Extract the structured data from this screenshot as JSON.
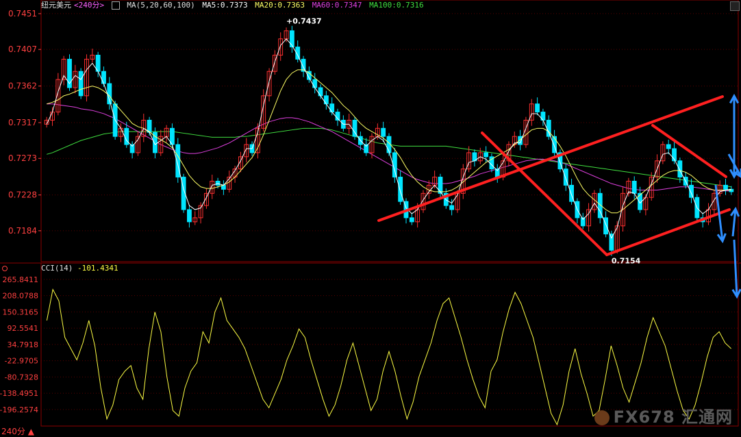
{
  "header": {
    "symbol": "纽元美元",
    "period": "<240分>",
    "ma_icon": "ma-indicator-icon",
    "ma_params": "MA(5,20,60,100)",
    "ma5": "MA5:0.7373",
    "ma20": "MA20:0.7363",
    "ma60": "MA60:0.7347",
    "ma100": "MA100:0.7316"
  },
  "cci_header": {
    "name": "CCI(14)",
    "value": "-101.4341"
  },
  "footer": {
    "period_label": "240分 ▲"
  },
  "watermark": {
    "text": "FX678 汇通网"
  },
  "colors": {
    "up": "#ff3030",
    "down": "#00e5ff",
    "ma5": "#ffffff",
    "ma20": "#ffff66",
    "ma60": "#e040e0",
    "ma100": "#40e040",
    "cci": "#ffff44",
    "trend_red": "#ff2020",
    "arrow_blue": "#2f8fff",
    "axis_text": "#ff4040"
  },
  "chart_data": [
    {
      "type": "candlestick",
      "title": "纽元美元<240分>",
      "ylim": [
        0.7146,
        0.7456
      ],
      "y_ticks": [
        "0.7451",
        "0.7407",
        "0.7362",
        "0.7317",
        "0.7273",
        "0.7228",
        "0.7184"
      ],
      "annotations": [
        {
          "label": "+0.7437",
          "value": 0.7437,
          "kind": "high"
        },
        {
          "label": "0.7154",
          "value": 0.7154,
          "kind": "low"
        }
      ],
      "close": [
        0.732,
        0.733,
        0.737,
        0.7395,
        0.736,
        0.738,
        0.735,
        0.7395,
        0.74,
        0.738,
        0.7365,
        0.734,
        0.73,
        0.731,
        0.729,
        0.728,
        0.73,
        0.732,
        0.7305,
        0.728,
        0.73,
        0.731,
        0.729,
        0.725,
        0.721,
        0.7195,
        0.72,
        0.7215,
        0.723,
        0.7245,
        0.724,
        0.7235,
        0.725,
        0.726,
        0.7275,
        0.729,
        0.728,
        0.731,
        0.735,
        0.738,
        0.74,
        0.742,
        0.743,
        0.741,
        0.7395,
        0.738,
        0.737,
        0.736,
        0.735,
        0.734,
        0.733,
        0.732,
        0.731,
        0.732,
        0.73,
        0.729,
        0.728,
        0.73,
        0.731,
        0.73,
        0.728,
        0.725,
        0.722,
        0.72,
        0.7195,
        0.721,
        0.723,
        0.724,
        0.725,
        0.723,
        0.7215,
        0.721,
        0.723,
        0.726,
        0.728,
        0.727,
        0.728,
        0.7275,
        0.726,
        0.725,
        0.727,
        0.729,
        0.73,
        0.729,
        0.732,
        0.734,
        0.733,
        0.732,
        0.73,
        0.728,
        0.726,
        0.724,
        0.722,
        0.72,
        0.719,
        0.721,
        0.723,
        0.72,
        0.718,
        0.716,
        0.719,
        0.723,
        0.7245,
        0.723,
        0.721,
        0.7225,
        0.725,
        0.727,
        0.729,
        0.7285,
        0.727,
        0.725,
        0.724,
        0.7225,
        0.72,
        0.7195,
        0.721,
        0.723,
        0.724,
        0.7235,
        0.7232
      ],
      "ma": {
        "MA5": [
          0.7315,
          0.733,
          0.7355,
          0.7375,
          0.7365,
          0.7375,
          0.737,
          0.7382,
          0.739,
          0.738,
          0.7365,
          0.7345,
          0.732,
          0.731,
          0.7295,
          0.7288,
          0.7296,
          0.731,
          0.7305,
          0.729,
          0.7295,
          0.73,
          0.729,
          0.7265,
          0.7235,
          0.7215,
          0.721,
          0.7212,
          0.7225,
          0.724,
          0.7242,
          0.724,
          0.7248,
          0.7258,
          0.727,
          0.7285,
          0.7285,
          0.7305,
          0.7338,
          0.7368,
          0.7392,
          0.7412,
          0.742,
          0.7412,
          0.74,
          0.7385,
          0.7372,
          0.736,
          0.735,
          0.734,
          0.733,
          0.7322,
          0.7315,
          0.7315,
          0.7305,
          0.7295,
          0.7288,
          0.7295,
          0.73,
          0.7295,
          0.7282,
          0.7258,
          0.7232,
          0.7212,
          0.7205,
          0.721,
          0.7222,
          0.7232,
          0.724,
          0.7232,
          0.7222,
          0.7218,
          0.7228,
          0.725,
          0.7268,
          0.727,
          0.7275,
          0.7272,
          0.7265,
          0.7258,
          0.7268,
          0.7282,
          0.7292,
          0.7292,
          0.731,
          0.7328,
          0.7328,
          0.732,
          0.7305,
          0.7288,
          0.7268,
          0.7248,
          0.7228,
          0.721,
          0.7198,
          0.7205,
          0.7218,
          0.7208,
          0.7192,
          0.7175,
          0.7188,
          0.7215,
          0.7232,
          0.723,
          0.7218,
          0.7225,
          0.7242,
          0.726,
          0.7278,
          0.728,
          0.7272,
          0.7258,
          0.7245,
          0.723,
          0.7212,
          0.7205,
          0.721,
          0.7222,
          0.7232,
          0.7234,
          0.7235
        ],
        "MA20": [
          0.734,
          0.7342,
          0.7345,
          0.735,
          0.7352,
          0.7355,
          0.7358,
          0.736,
          0.7362,
          0.736,
          0.7356,
          0.735,
          0.734,
          0.7332,
          0.7324,
          0.7316,
          0.7312,
          0.731,
          0.7306,
          0.73,
          0.7296,
          0.7292,
          0.7286,
          0.7276,
          0.7264,
          0.7252,
          0.7244,
          0.7238,
          0.7236,
          0.7236,
          0.7238,
          0.724,
          0.7244,
          0.725,
          0.7258,
          0.7266,
          0.7274,
          0.7286,
          0.7302,
          0.732,
          0.7338,
          0.7356,
          0.737,
          0.7378,
          0.7382,
          0.7382,
          0.7378,
          0.7372,
          0.7366,
          0.736,
          0.7354,
          0.7346,
          0.7338,
          0.7332,
          0.7324,
          0.7316,
          0.731,
          0.7306,
          0.7302,
          0.7298,
          0.7292,
          0.7284,
          0.7274,
          0.7262,
          0.7252,
          0.7244,
          0.7238,
          0.7234,
          0.7232,
          0.7232,
          0.7232,
          0.7234,
          0.7238,
          0.7244,
          0.725,
          0.7256,
          0.7262,
          0.7268,
          0.7272,
          0.7276,
          0.728,
          0.7284,
          0.729,
          0.7296,
          0.7302,
          0.7308,
          0.731,
          0.731,
          0.7306,
          0.7298,
          0.7288,
          0.7276,
          0.7262,
          0.7248,
          0.7236,
          0.7228,
          0.7222,
          0.7216,
          0.721,
          0.7206,
          0.7206,
          0.721,
          0.7216,
          0.7222,
          0.7228,
          0.7234,
          0.724,
          0.7246,
          0.7252,
          0.7256,
          0.7258,
          0.7258,
          0.7256,
          0.7252,
          0.7246,
          0.724,
          0.7236,
          0.7234,
          0.7234,
          0.7234,
          0.7234
        ],
        "MA60": [
          0.734,
          0.734,
          0.7339,
          0.7338,
          0.7337,
          0.7336,
          0.7334,
          0.7333,
          0.7332,
          0.733,
          0.7328,
          0.7325,
          0.7322,
          0.7318,
          0.7314,
          0.731,
          0.7306,
          0.7302,
          0.7298,
          0.7294,
          0.729,
          0.7287,
          0.7284,
          0.7282,
          0.728,
          0.7279,
          0.7279,
          0.728,
          0.7282,
          0.7284,
          0.7286,
          0.7289,
          0.7292,
          0.7296,
          0.73,
          0.7304,
          0.7308,
          0.7312,
          0.7315,
          0.7318,
          0.732,
          0.7322,
          0.7323,
          0.7323,
          0.7322,
          0.732,
          0.7318,
          0.7315,
          0.7312,
          0.7309,
          0.7306,
          0.7302,
          0.7298,
          0.7294,
          0.729,
          0.7286,
          0.7282,
          0.7278,
          0.7274,
          0.727,
          0.7266,
          0.7262,
          0.7258,
          0.7254,
          0.725,
          0.7247,
          0.7245,
          0.7243,
          0.7242,
          0.7242,
          0.7242,
          0.7243,
          0.7245,
          0.7247,
          0.7249,
          0.7251,
          0.7254,
          0.7256,
          0.7258,
          0.726,
          0.7262,
          0.7264,
          0.7266,
          0.7268,
          0.727,
          0.7271,
          0.7272,
          0.7272,
          0.7271,
          0.727,
          0.7268,
          0.7266,
          0.7263,
          0.726,
          0.7257,
          0.7254,
          0.7251,
          0.7248,
          0.7245,
          0.7242,
          0.724,
          0.7238,
          0.7236,
          0.7235,
          0.7234,
          0.7234,
          0.7234,
          0.7234,
          0.7235,
          0.7236,
          0.7237,
          0.7238,
          0.7238,
          0.7238,
          0.7237,
          0.7236,
          0.7235,
          0.7234,
          0.7233,
          0.7233,
          0.7233
        ],
        "MA100": [
          0.7278,
          0.728,
          0.7283,
          0.7286,
          0.7289,
          0.7292,
          0.7295,
          0.7297,
          0.7299,
          0.7301,
          0.7303,
          0.7304,
          0.7305,
          0.7306,
          0.7306,
          0.7306,
          0.7306,
          0.7306,
          0.7306,
          0.7306,
          0.7306,
          0.7306,
          0.7306,
          0.7305,
          0.7304,
          0.7303,
          0.7302,
          0.7301,
          0.73,
          0.7299,
          0.7299,
          0.7299,
          0.7299,
          0.7299,
          0.73,
          0.73,
          0.7301,
          0.7302,
          0.7303,
          0.7304,
          0.7305,
          0.7306,
          0.7307,
          0.7308,
          0.7309,
          0.731,
          0.731,
          0.731,
          0.731,
          0.7309,
          0.7308,
          0.7306,
          0.7304,
          0.7302,
          0.73,
          0.7298,
          0.7296,
          0.7294,
          0.7292,
          0.7291,
          0.729,
          0.7289,
          0.7288,
          0.7288,
          0.7288,
          0.7288,
          0.7288,
          0.7288,
          0.7288,
          0.7288,
          0.7288,
          0.7287,
          0.7286,
          0.7285,
          0.7284,
          0.7283,
          0.7282,
          0.7281,
          0.728,
          0.7279,
          0.7278,
          0.7277,
          0.7276,
          0.7275,
          0.7274,
          0.7273,
          0.7272,
          0.7271,
          0.727,
          0.7269,
          0.7268,
          0.7267,
          0.7266,
          0.7265,
          0.7264,
          0.7263,
          0.7262,
          0.7261,
          0.726,
          0.7259,
          0.7258,
          0.7257,
          0.7256,
          0.7255,
          0.7254,
          0.7253,
          0.7252,
          0.7251,
          0.725,
          0.7249,
          0.7248,
          0.7247,
          0.7246,
          0.7245,
          0.7244,
          0.7243,
          0.7242,
          0.7241,
          0.724,
          0.7239,
          0.7238
        ]
      }
    },
    {
      "type": "line",
      "title": "CCI(14)",
      "ylim": [
        -255,
        290
      ],
      "y_ticks": [
        "265.8411",
        "208.0788",
        "150.3165",
        "92.5541",
        "34.7918",
        "-22.9705",
        "-80.7328",
        "-138.4951",
        "-196.2574"
      ],
      "values": [
        120,
        230,
        190,
        60,
        20,
        -20,
        40,
        120,
        30,
        -120,
        -230,
        -180,
        -90,
        -60,
        -40,
        -120,
        -160,
        20,
        150,
        80,
        -80,
        -200,
        -220,
        -120,
        -60,
        -30,
        80,
        40,
        150,
        200,
        120,
        90,
        60,
        20,
        -40,
        -100,
        -160,
        -190,
        -140,
        -90,
        -20,
        30,
        90,
        60,
        -20,
        -90,
        -160,
        -220,
        -180,
        -110,
        -20,
        40,
        -40,
        -120,
        -200,
        -160,
        -60,
        10,
        -60,
        -150,
        -230,
        -170,
        -80,
        -20,
        40,
        120,
        180,
        200,
        130,
        60,
        -20,
        -90,
        -150,
        -190,
        -60,
        -20,
        80,
        160,
        220,
        180,
        120,
        60,
        -30,
        -120,
        -210,
        -250,
        -180,
        -60,
        20,
        -70,
        -140,
        -220,
        -200,
        -90,
        30,
        -40,
        -120,
        -170,
        -100,
        -30,
        60,
        130,
        80,
        30,
        -50,
        -130,
        -200,
        -230,
        -180,
        -100,
        -10,
        60,
        80,
        40,
        20
      ]
    }
  ]
}
